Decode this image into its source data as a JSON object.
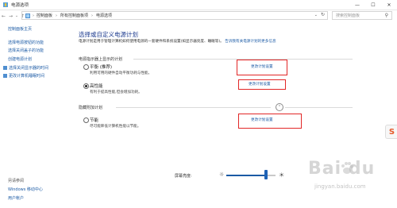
{
  "window": {
    "title": "电源选项",
    "minimize_glyph": "—",
    "maximize_glyph": "☐",
    "close_glyph": "✕"
  },
  "nav": {
    "back_glyph": "←",
    "forward_glyph": "→",
    "recent_glyph": "⌄",
    "up_glyph": "↑",
    "breadcrumb": [
      "控制面板",
      "所有控制面板项",
      "电源选项"
    ],
    "breadcrumb_sep": "›",
    "search_placeholder": "搜索控制面板"
  },
  "sidebar": {
    "items": [
      {
        "label": "控制面板主页"
      },
      {
        "label": "选择电源按钮的功能"
      },
      {
        "label": "选择关闭盖子的功能"
      },
      {
        "label": "创建电源计划"
      },
      {
        "label": "选择关闭显示器的时间"
      },
      {
        "label": "更改计算机睡眠时间"
      }
    ],
    "see_also": "另请参阅",
    "footer_items": [
      {
        "label": "Windows 移动中心"
      },
      {
        "label": "用户帐户"
      }
    ]
  },
  "main": {
    "title": "选择或自定义电源计划",
    "description": "电源计划是用于管理计算机如何使用电源的一套硬件和系统设置(如显示器亮度、睡眠等)。",
    "description_link": "告诉我有关电源计划的更多信息",
    "section_selected": "电源指示器上显示的计划",
    "section_hidden": "隐藏附加计划",
    "plans": [
      {
        "name": "平衡 (推荐)",
        "description": "利用可用的硬件自动平衡功耗与性能。",
        "link": "更改计划设置",
        "selected": false
      },
      {
        "name": "高性能",
        "description": "有利于提高性能,但会增加功耗。",
        "link": "更改计划设置",
        "selected": true
      },
      {
        "name": "节能",
        "description": "尽可能降低计算机性能以节能。",
        "link": "更改计划设置",
        "selected": false
      }
    ],
    "brightness_label": "屏幕亮度:",
    "brightness_value": 0.8
  },
  "watermark": {
    "logo_text": "Bai du",
    "sub_text": "jingyan.baidu.com"
  },
  "ime": {
    "label": "S"
  },
  "colors": {
    "link": "#1b5aa5",
    "heading": "#1d3b8f",
    "highlight_box": "#e22727"
  }
}
